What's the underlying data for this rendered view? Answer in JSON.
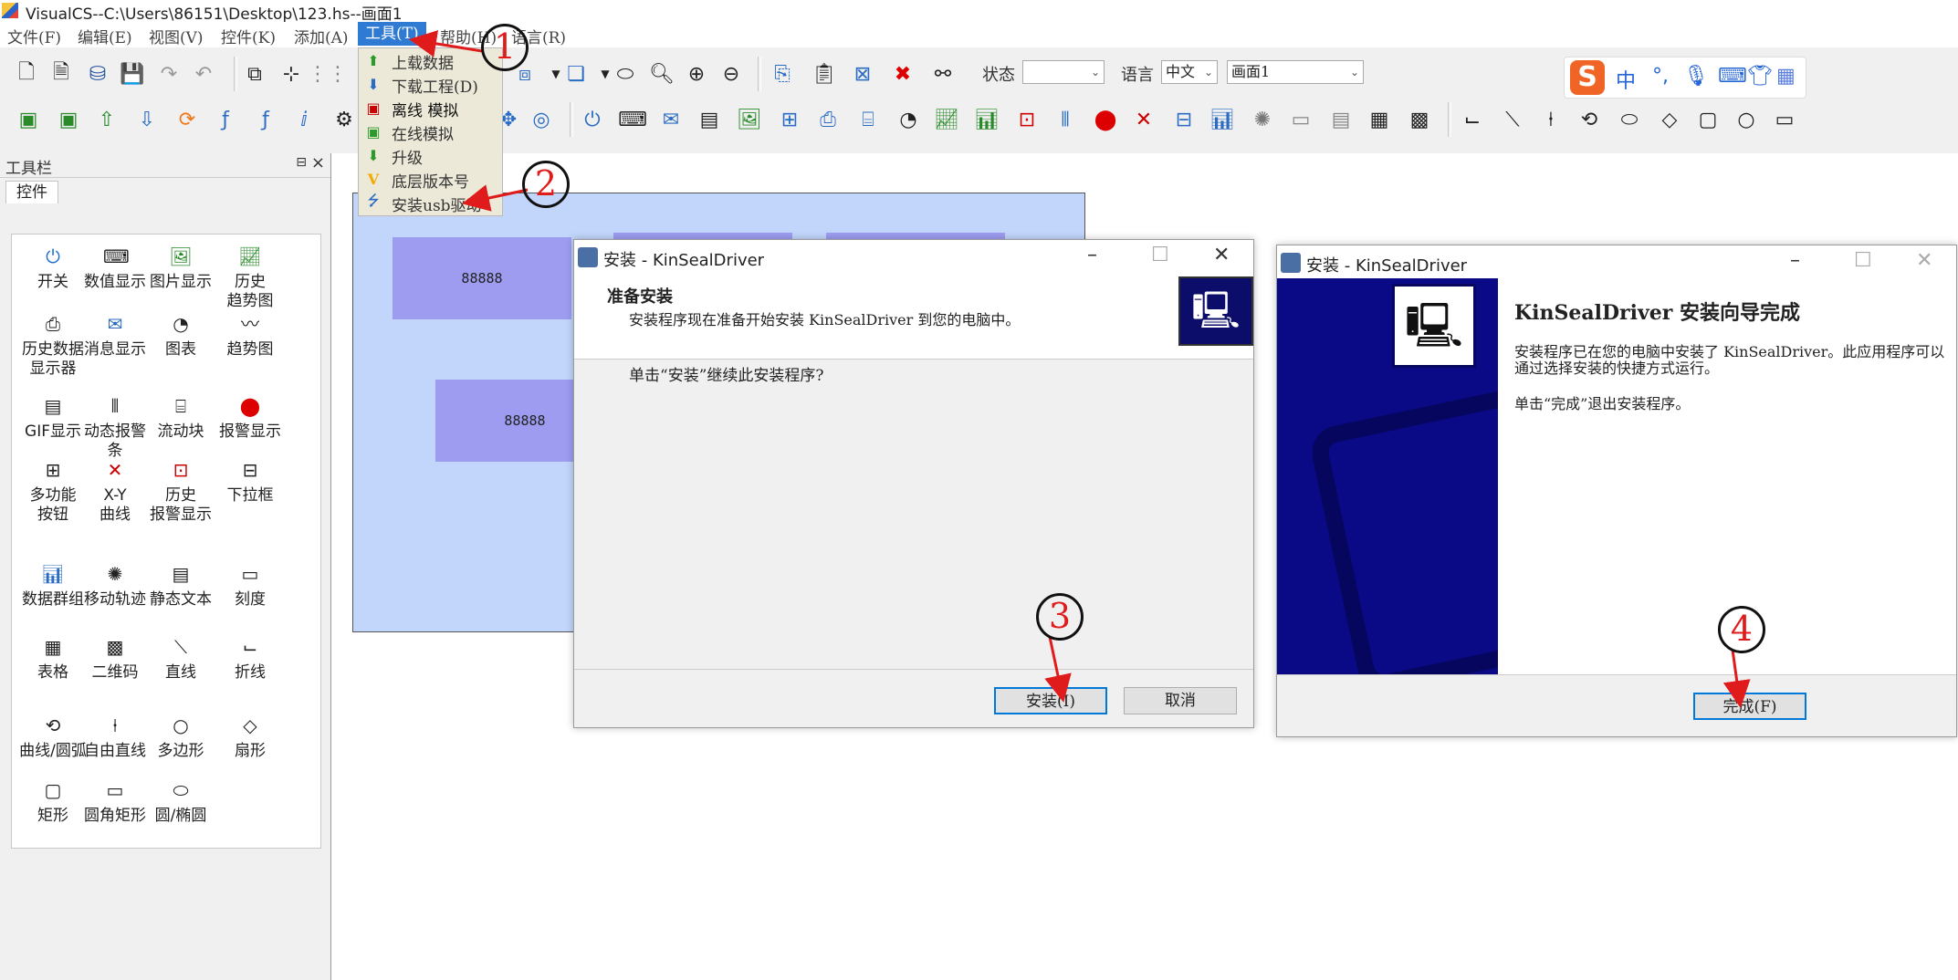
{
  "window": {
    "title": "VisualCS--C:\\Users\\86151\\Desktop\\123.hs--画面1"
  },
  "menubar": [
    "文件(F)",
    "编辑(E)",
    "视图(V)",
    "控件(K)",
    "添加(A)",
    "工具(T)",
    "帮助(H)",
    "语言(R)"
  ],
  "tools_menu": {
    "items": [
      {
        "label": "上载数据",
        "icon": "upload-icon"
      },
      {
        "label": "下载工程(D)",
        "icon": "download-icon"
      },
      {
        "label": "离线 模拟",
        "icon": "offline-sim-icon"
      },
      {
        "label": "在线模拟",
        "icon": "online-sim-icon"
      },
      {
        "label": "升级",
        "icon": "upgrade-icon"
      },
      {
        "label": "底层版本号",
        "icon": "version-icon"
      },
      {
        "label": "安装usb驱动",
        "icon": "usb-icon"
      }
    ]
  },
  "toolbar": {
    "status_label": "状态",
    "status_value": "",
    "language_label": "语言",
    "language_value": "中文",
    "screen_value": "画面1"
  },
  "ime": {
    "mode": "中",
    "punct": "°,",
    "colors": {
      "logo": "#f06525",
      "icon": "#2565d6"
    }
  },
  "toolbox": {
    "title": "工具栏",
    "tab": "控件",
    "controls": [
      [
        "开关",
        "数值显示",
        "图片显示",
        "历史\n趋势图"
      ],
      [
        "历史数据\n显示器",
        "消息显示",
        "图表",
        "趋势图"
      ],
      [
        "GIF显示",
        "动态报警条",
        "流动块",
        "报警显示"
      ],
      [
        "多功能\n按钮",
        "X-Y\n曲线",
        "历史\n报警显示",
        "下拉框"
      ],
      [
        "数据群组",
        "移动轨迹",
        "静态文本",
        "刻度"
      ],
      [
        "表格",
        "二维码",
        "直线",
        "折线"
      ],
      [
        "曲线/圆弧",
        "自由直线",
        "多边形",
        "扇形"
      ],
      [
        "矩形",
        "圆角矩形",
        "圆/椭圆"
      ]
    ]
  },
  "canvas": {
    "numbox_1": "88888",
    "numbox_2": "88888"
  },
  "dialog1": {
    "title": "安装 - KinSealDriver",
    "heading": "准备安装",
    "sub": "安装程序现在准备开始安装 KinSealDriver 到您的电脑中。",
    "body": "单击“安装”继续此安装程序?",
    "install": "安装(I)",
    "cancel": "取消"
  },
  "dialog2": {
    "title": "安装 - KinSealDriver",
    "heading": "KinSealDriver 安装向导完成",
    "body1": "安装程序已在您的电脑中安装了 KinSealDriver。此应用程序可以通过选择安装的快捷方式运行。",
    "body2": "单击“完成”退出安装程序。",
    "finish": "完成(F)"
  },
  "annotations": [
    "1",
    "2",
    "3",
    "4"
  ],
  "colors": {
    "accent": "#2f7ad3",
    "canvas": "#c2d6fb",
    "numbox": "#9d9cf1",
    "wizard_side": "#0a0a86",
    "annotation": "#e01b1b"
  }
}
